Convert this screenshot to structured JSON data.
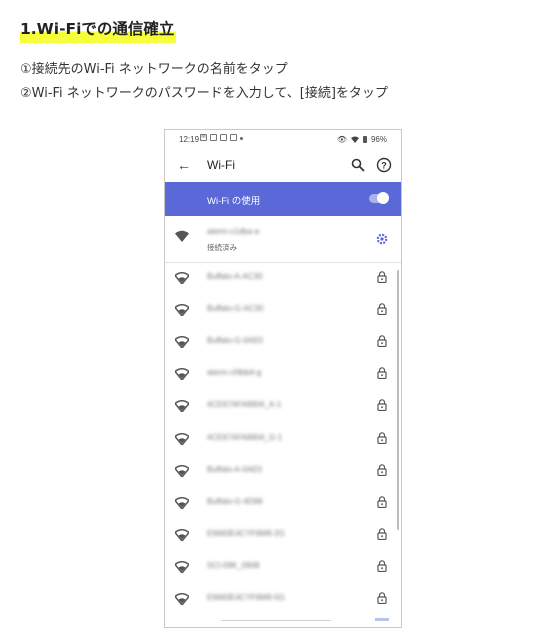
{
  "heading": "1.Wi-Fiでの通信確立",
  "steps": [
    "①接続先のWi-Fi ネットワークの名前をタップ",
    "②Wi-Fi ネットワークのパスワードを入力して、[接続]をタップ"
  ],
  "phone": {
    "status": {
      "time": "12:19",
      "battery": "96%"
    },
    "toolbar": {
      "title": "Wi-Fi"
    },
    "toggle": {
      "label": "Wi-Fi の使用",
      "state": "on"
    },
    "connected": {
      "name": "aterm-c1dba-a",
      "status": "接続済み"
    },
    "networks": [
      "Buffalo-A-AC30",
      "Buffalo-G-AC30",
      "Buffalo-G-0AE0",
      "aterm-cf4bb4-g",
      "4CE67AFA8904_A-1",
      "4CE67AFA8904_G-1",
      "Buffalo-A-0AE0",
      "Buffalo-G-4D98",
      "E6683E4CYF8M9-2G",
      "SCI-09K_0908",
      "E6683E4CYF8M9-5G"
    ],
    "icons": {
      "wifi": "wifi-icon",
      "lock": "lock-icon",
      "gear": "gear-icon",
      "search": "search-icon",
      "help": "help-icon",
      "back": "back-arrow-icon"
    },
    "colors": {
      "accent": "#5a68d8"
    }
  }
}
